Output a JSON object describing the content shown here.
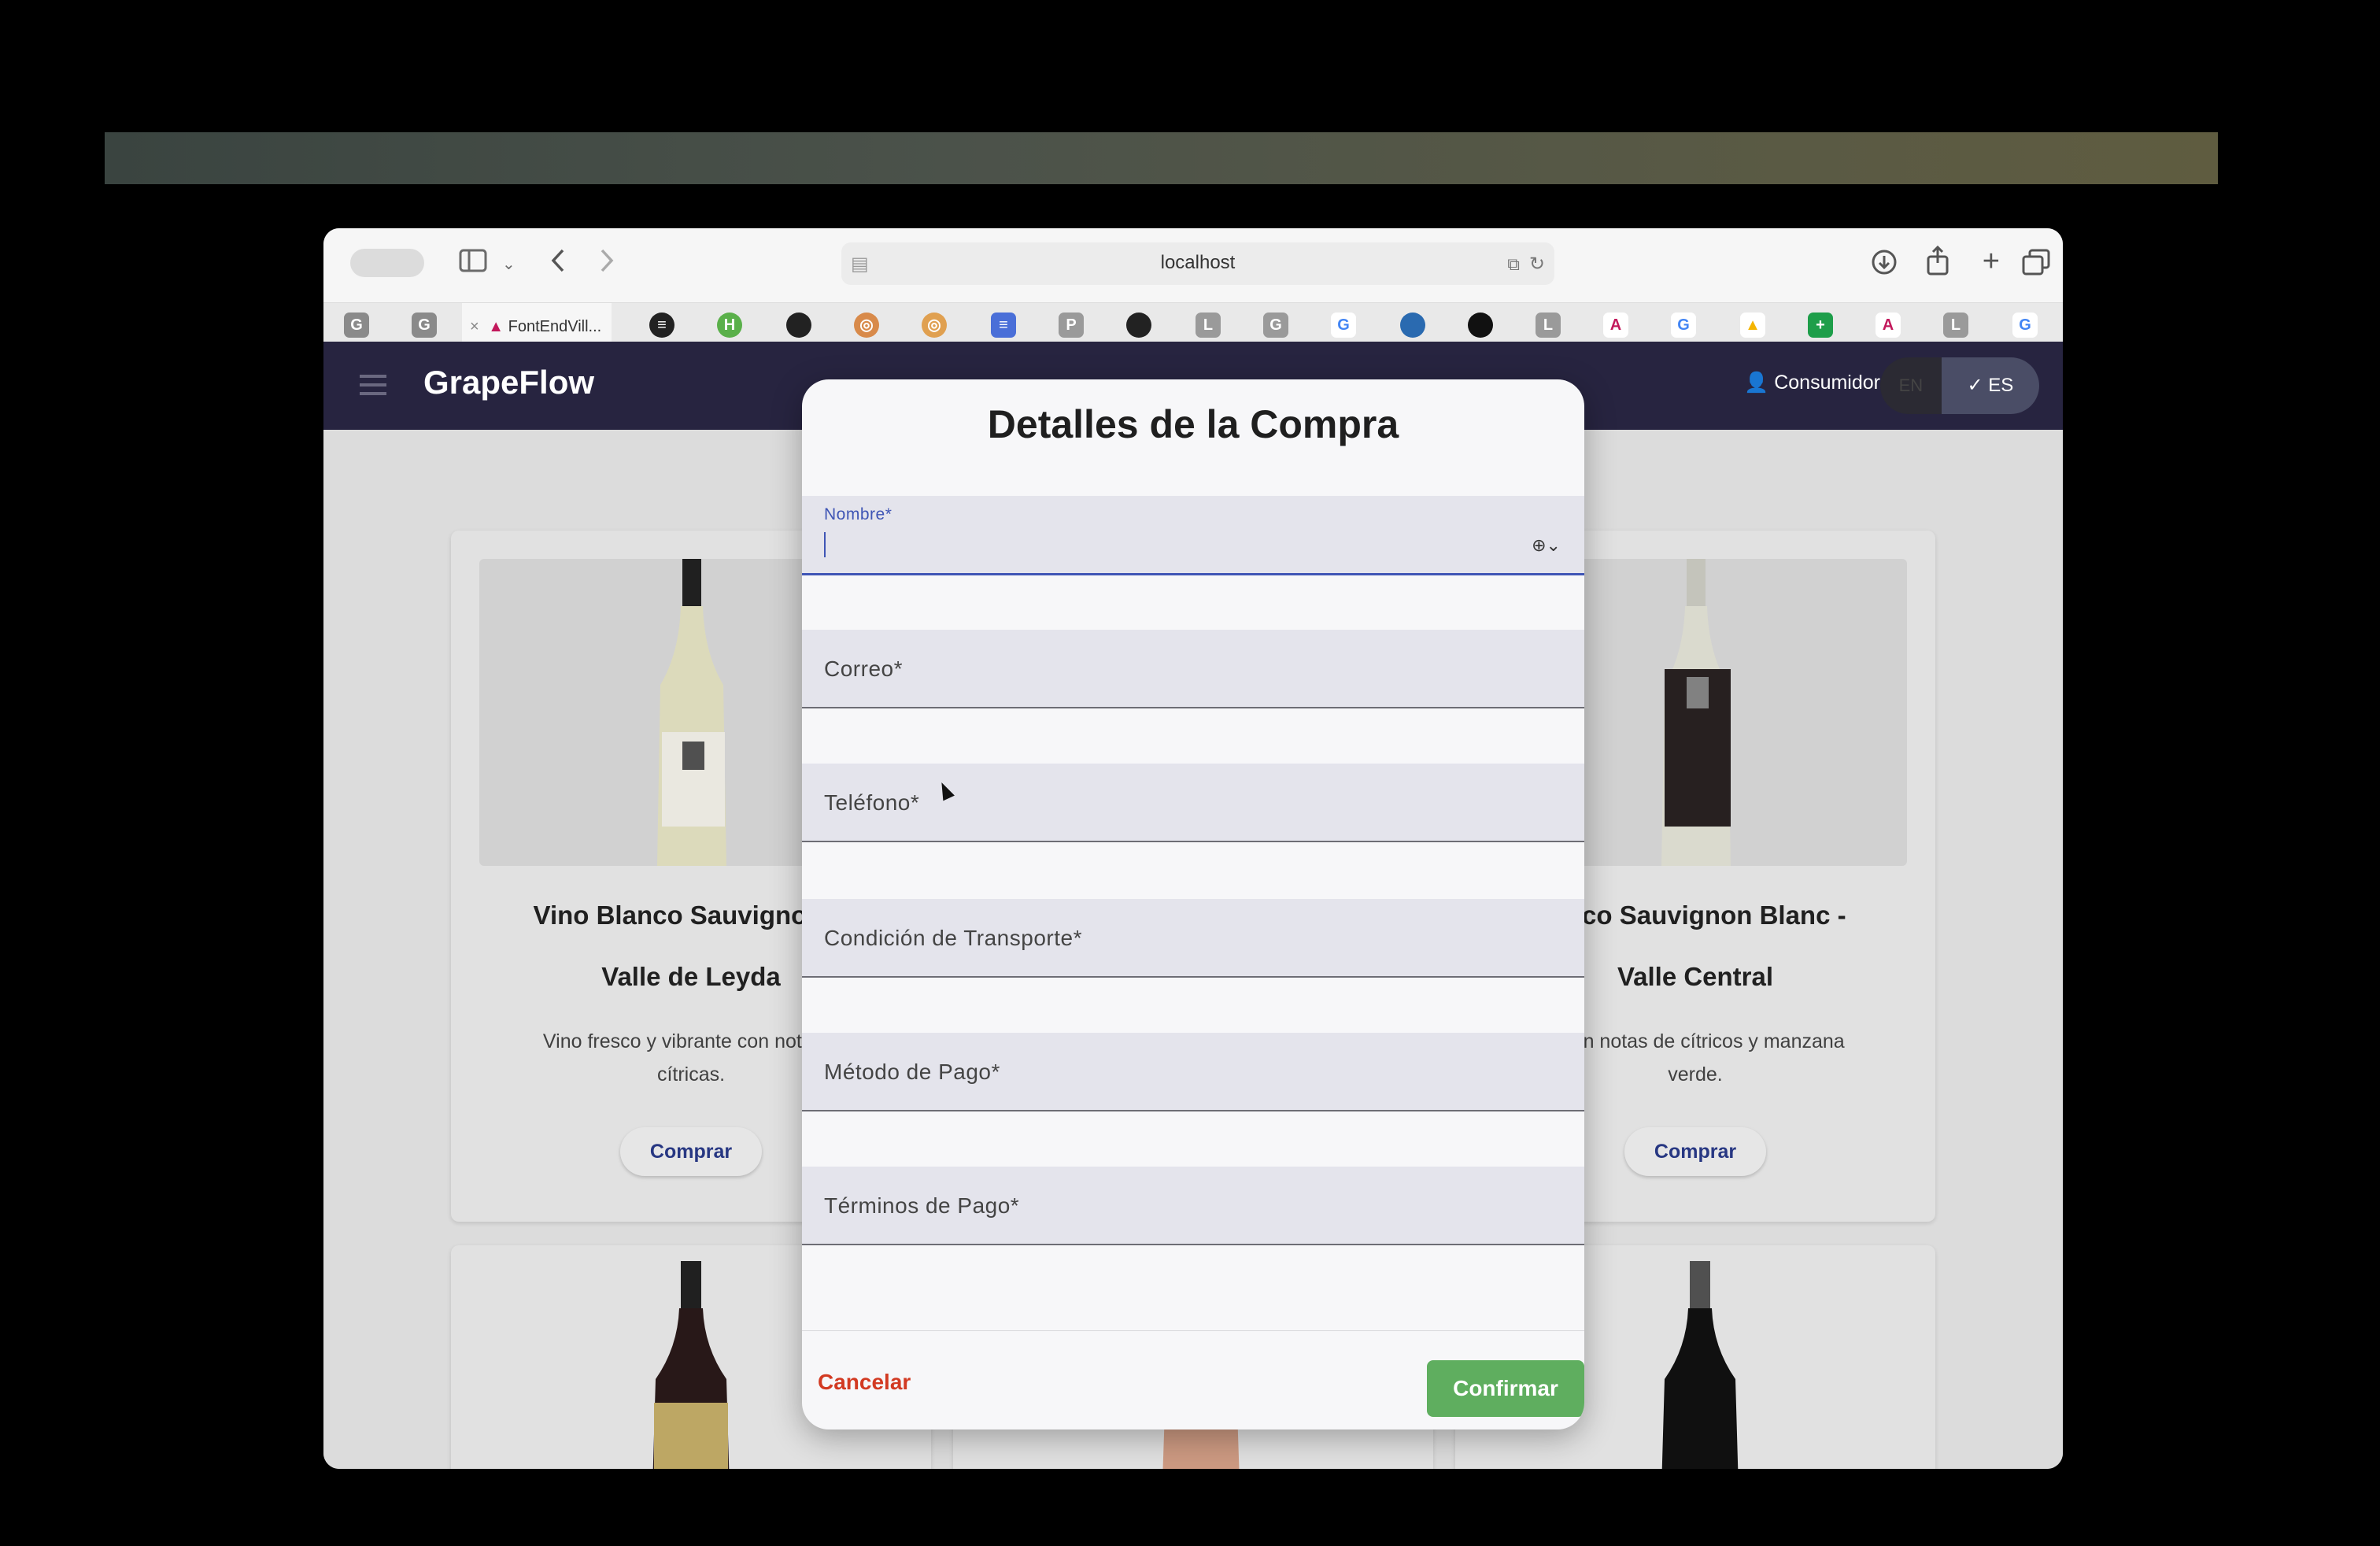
{
  "browser": {
    "url": "localhost",
    "active_tab_label": "FontEndVill..."
  },
  "tab_icons": [
    "G",
    "G",
    "A",
    "≡",
    "H",
    "gh",
    "◎",
    "◎",
    "≡",
    "P",
    "gh",
    "L",
    "G",
    "G",
    "●",
    "●",
    "L",
    "A",
    "G",
    "▲",
    "+",
    "A",
    "L",
    "G"
  ],
  "app": {
    "brand": "GrapeFlow",
    "user_label": "Consumidor",
    "lang_en": "EN",
    "lang_es": "ES"
  },
  "cards": [
    {
      "title_line1": "Vino Blanco Sauvignon B",
      "title_line2": "Valle de Leyda",
      "desc_line1": "Vino fresco y vibrante con notas h",
      "desc_line2": "cítricas.",
      "button": "Comprar"
    },
    {
      "title_line1": "lanco Sauvignon Blanc -",
      "title_line2": "Valle Central",
      "desc_line1": "o con notas de cítricos y manzana",
      "desc_line2": "verde.",
      "button": "Comprar"
    }
  ],
  "dialog": {
    "title": "Detalles de la Compra",
    "fields": {
      "nombre": "Nombre*",
      "correo": "Correo*",
      "telefono": "Teléfono*",
      "transporte": "Condición de Transporte*",
      "metodo": "Método de Pago*",
      "terminos": "Términos de Pago*"
    },
    "cancel": "Cancelar",
    "confirm": "Confirmar"
  },
  "colors": {
    "appbar": "#272440",
    "confirm": "#5fae5f",
    "cancel": "#d23a22",
    "focus": "#3f55b5"
  }
}
